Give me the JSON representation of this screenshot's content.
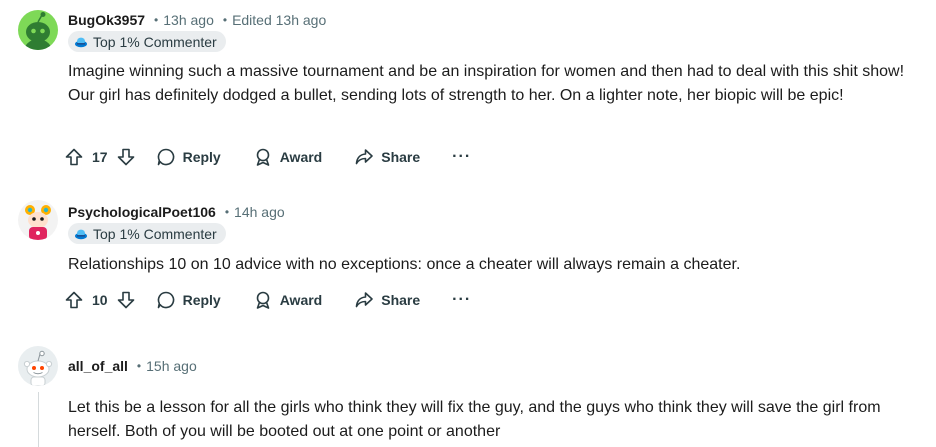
{
  "comments": [
    {
      "username": "BugOk3957",
      "time": "13h ago",
      "edited": "Edited 13h ago",
      "flair": "Top 1% Commenter",
      "text": "Imagine winning such a massive tournament and be an inspiration for women and then had to deal with this shit show! Our girl has definitely dodged a bullet, sending lots of strength to her. On a lighter note, her biopic will be epic!",
      "score": "17",
      "reply_label": "Reply",
      "award_label": "Award",
      "share_label": "Share",
      "more_label": "···",
      "avatar_icon": "snoo-green-avatar"
    },
    {
      "username": "PsychologicalPoet106",
      "time": "14h ago",
      "flair": "Top 1% Commenter",
      "text": "Relationships 10 on 10 advice with no exceptions: once a cheater will always remain a cheater.",
      "score": "10",
      "reply_label": "Reply",
      "award_label": "Award",
      "share_label": "Share",
      "more_label": "···",
      "avatar_icon": "snoo-pink-avatar"
    },
    {
      "username": "all_of_all",
      "time": "15h ago",
      "text": "Let this be a lesson for all the girls who think they will fix the guy, and the guys who think they will save the girl from herself. Both of you will be booted out at one point or another",
      "avatar_icon": "snoo-default-avatar"
    }
  ],
  "separator": "•",
  "colors": {
    "text": "#1c1c1c",
    "meta": "#576f76",
    "action": "#2a3c42",
    "flair_bg": "#eaedef",
    "thread_line": "#d5dadc"
  }
}
